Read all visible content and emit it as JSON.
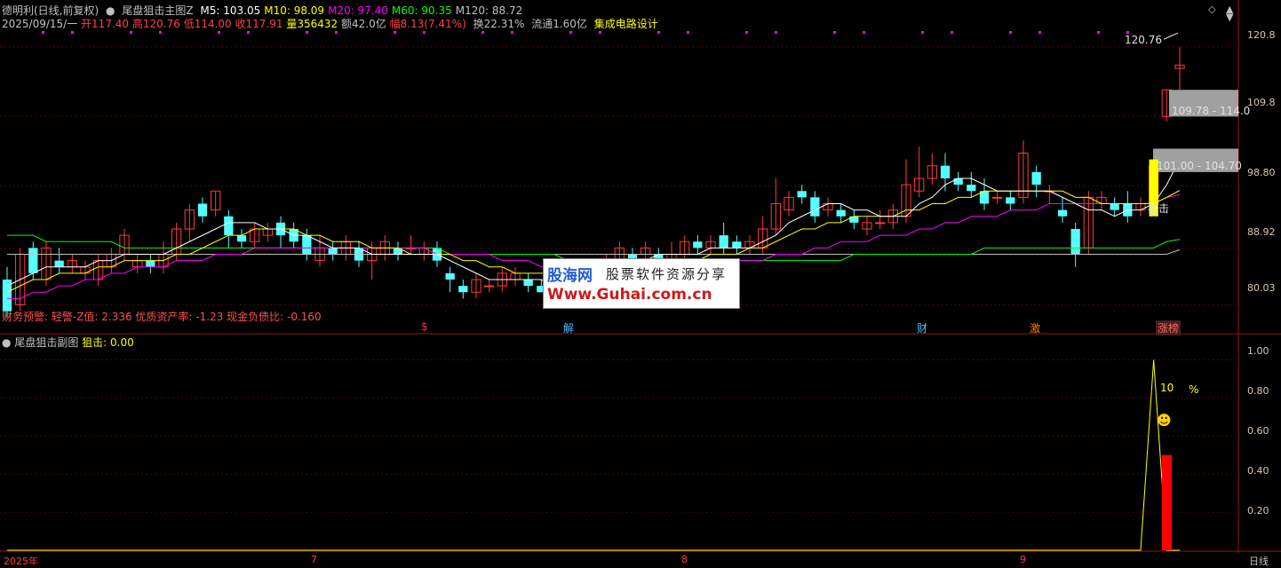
{
  "main_panel": {
    "title": "德明利(日线,前复权)",
    "indicator_name": "尾盘狙击主图Z",
    "ma": [
      {
        "label": "M5: 103.05",
        "color": "#ffffff"
      },
      {
        "label": "M10: 98.09",
        "color": "#ffff00"
      },
      {
        "label": "M20: 97.40",
        "color": "#ff00ff"
      },
      {
        "label": "M60: 90.35",
        "color": "#00ff00"
      },
      {
        "label": "M120: 88.72",
        "color": "#c0c0c0"
      }
    ],
    "quote": {
      "date": "2025/09/15/一",
      "open": "开117.40",
      "high": "高120.76",
      "low": "低114.00",
      "close": "收117.91",
      "volume": "量356432",
      "amount": "额42.0亿",
      "change": "幅8.13(7.41%)",
      "turnover": "换22.31%",
      "float": "流通1.60亿",
      "sector": "集成电路设计"
    },
    "finance_note": "财务预警: 轻警-Z值: 2.336 优质资产率: -1.23 现金负债比: -0.160",
    "price_ticks": [
      "120.8",
      "109.8",
      "98.80",
      "88.92",
      "80.03"
    ],
    "high_label": "120.76",
    "zone_labels": [
      "109.78 - 114.0",
      "101.00 - 104.70"
    ],
    "signal_label": "狙击",
    "events": [
      {
        "text": "$",
        "color": "#ff3030"
      },
      {
        "text": "解",
        "color": "#40c0ff"
      },
      {
        "text": "财",
        "color": "#40c0ff"
      },
      {
        "text": "激",
        "color": "#ff8000"
      },
      {
        "text": "涨榜",
        "color": "#ff6060"
      }
    ]
  },
  "sub_panel": {
    "title": "尾盘狙击副图",
    "value": "狙击: 0.00",
    "ticks": [
      "1.00",
      "0.80",
      "0.60",
      "0.40",
      "0.20"
    ],
    "annotation_value": "10",
    "annotation_unit": "%",
    "smiley": "☻"
  },
  "x_axis": {
    "labels": [
      "2025年",
      "7",
      "8",
      "9"
    ],
    "period": "日线"
  },
  "watermark": {
    "name": "股海网",
    "slogan": "股票软件资源分享",
    "url": "Www.Guhai.com.cn"
  },
  "window_controls": [
    "◇",
    "▲",
    "▼"
  ],
  "chart_data": {
    "type": "candlestick",
    "ylim": [
      76,
      124
    ],
    "candles": [
      [
        84,
        79,
        86,
        78
      ],
      [
        80,
        88,
        89,
        79
      ],
      [
        89,
        85,
        90,
        84
      ],
      [
        84,
        89,
        90,
        83
      ],
      [
        87,
        86,
        89,
        85
      ],
      [
        86,
        87,
        88,
        85
      ],
      [
        85,
        86,
        87,
        84
      ],
      [
        84,
        87,
        88,
        83
      ],
      [
        86,
        88,
        89,
        85
      ],
      [
        88,
        91,
        92,
        87
      ],
      [
        86,
        87,
        88,
        85
      ],
      [
        87,
        86,
        88,
        85
      ],
      [
        86,
        88,
        90,
        85
      ],
      [
        88,
        92,
        93,
        87
      ],
      [
        92,
        95,
        96,
        90
      ],
      [
        96,
        94,
        97,
        93
      ],
      [
        95,
        98,
        98,
        94
      ],
      [
        94,
        91,
        95,
        89
      ],
      [
        91,
        90,
        92,
        89
      ],
      [
        90,
        92,
        93,
        89
      ],
      [
        91,
        92,
        93,
        90
      ],
      [
        93,
        91,
        94,
        89
      ],
      [
        92,
        90,
        93,
        89
      ],
      [
        91,
        88,
        92,
        87
      ],
      [
        87,
        89,
        91,
        86
      ],
      [
        89,
        88,
        90,
        87
      ],
      [
        88,
        90,
        91,
        87
      ],
      [
        89,
        87,
        90,
        86
      ],
      [
        87,
        89,
        90,
        84
      ],
      [
        88,
        90,
        91,
        87
      ],
      [
        89,
        88,
        90,
        87
      ],
      [
        89,
        89,
        91,
        88
      ],
      [
        88,
        89,
        90,
        87
      ],
      [
        89,
        87,
        90,
        86
      ],
      [
        85,
        84,
        86,
        82
      ],
      [
        83,
        82,
        84,
        81
      ],
      [
        82,
        84,
        85,
        81
      ],
      [
        83,
        83,
        84,
        82
      ],
      [
        83,
        85,
        86,
        82
      ],
      [
        84,
        85,
        86,
        83
      ],
      [
        84,
        83,
        85,
        82
      ],
      [
        83,
        82,
        84,
        82
      ],
      [
        82,
        82,
        83,
        81
      ],
      [
        82,
        84,
        86,
        81
      ],
      [
        84,
        86,
        87,
        83
      ],
      [
        85,
        83,
        86,
        82
      ],
      [
        84,
        87,
        88,
        83
      ],
      [
        87,
        89,
        90,
        86
      ],
      [
        88,
        87,
        89,
        86
      ],
      [
        88,
        89,
        90,
        87
      ],
      [
        88,
        86,
        89,
        85
      ],
      [
        87,
        88,
        90,
        86
      ],
      [
        88,
        90,
        91,
        87
      ],
      [
        90,
        89,
        91,
        88
      ],
      [
        89,
        90,
        91,
        88
      ],
      [
        91,
        89,
        93,
        88
      ],
      [
        90,
        89,
        91,
        88
      ],
      [
        89,
        90,
        91,
        88
      ],
      [
        89,
        92,
        94,
        88
      ],
      [
        92,
        96,
        100,
        91
      ],
      [
        95,
        97,
        98,
        94
      ],
      [
        98,
        97,
        99,
        96
      ],
      [
        97,
        94,
        98,
        93
      ],
      [
        95,
        96,
        97,
        94
      ],
      [
        95,
        94,
        96,
        93
      ],
      [
        94,
        93,
        95,
        92
      ],
      [
        92,
        93,
        94,
        91
      ],
      [
        93,
        93,
        95,
        92
      ],
      [
        93,
        95,
        96,
        92
      ],
      [
        94,
        99,
        103,
        93
      ],
      [
        98,
        100,
        105,
        97
      ],
      [
        100,
        102,
        104,
        99
      ],
      [
        102,
        100,
        104,
        98
      ],
      [
        100,
        99,
        101,
        98
      ],
      [
        99,
        98,
        101,
        97
      ],
      [
        98,
        96,
        100,
        95
      ],
      [
        97,
        97,
        98,
        96
      ],
      [
        97,
        96,
        98,
        95
      ],
      [
        97,
        104,
        106,
        96
      ],
      [
        101,
        99,
        102,
        97
      ],
      [
        98,
        98,
        99,
        96
      ],
      [
        95,
        94,
        97,
        93
      ],
      [
        92,
        88,
        93,
        86
      ],
      [
        89,
        97,
        98,
        88
      ],
      [
        96,
        97,
        98,
        95
      ],
      [
        96,
        95,
        97,
        94
      ],
      [
        96,
        94,
        98,
        93
      ],
      [
        95,
        96,
        97,
        94
      ],
      [
        96,
        102,
        104,
        95
      ],
      [
        109.78,
        114,
        114,
        109
      ],
      [
        117.4,
        117.91,
        120.76,
        114
      ]
    ],
    "ma5": [
      83,
      84,
      85,
      86,
      86,
      86,
      86,
      87,
      87,
      88,
      88,
      88,
      88,
      89,
      90,
      91,
      92,
      93,
      93,
      93,
      92,
      92,
      91,
      91,
      90,
      89,
      89,
      89,
      88,
      88,
      88,
      88,
      88,
      88,
      87,
      86,
      85,
      84,
      84,
      84,
      84,
      84,
      83,
      83,
      84,
      84,
      84,
      85,
      86,
      87,
      88,
      88,
      88,
      88,
      89,
      89,
      89,
      89,
      90,
      91,
      93,
      94,
      95,
      96,
      96,
      95,
      95,
      94,
      94,
      94,
      96,
      97,
      99,
      100,
      100,
      99,
      98,
      98,
      98,
      98,
      98,
      97,
      96,
      95,
      95,
      94,
      95,
      95,
      96,
      99,
      103.05
    ],
    "ma10": [
      82,
      83,
      84,
      84,
      85,
      85,
      85,
      86,
      86,
      87,
      87,
      87,
      87,
      88,
      88,
      89,
      90,
      91,
      91,
      92,
      92,
      92,
      92,
      91,
      91,
      90,
      90,
      90,
      89,
      89,
      89,
      88,
      88,
      88,
      88,
      87,
      87,
      86,
      86,
      85,
      85,
      85,
      85,
      84,
      84,
      84,
      84,
      85,
      85,
      86,
      86,
      87,
      87,
      87,
      88,
      88,
      88,
      89,
      89,
      90,
      91,
      92,
      92,
      93,
      93,
      94,
      94,
      94,
      94,
      95,
      95,
      96,
      96,
      97,
      97,
      98,
      98,
      98,
      98,
      98,
      98,
      98,
      97,
      97,
      96,
      96,
      96,
      96,
      96,
      97,
      98.09
    ],
    "ma20": [
      81,
      81,
      82,
      82,
      83,
      83,
      84,
      84,
      85,
      85,
      86,
      86,
      86,
      87,
      87,
      87,
      88,
      88,
      88,
      89,
      89,
      89,
      89,
      89,
      89,
      89,
      89,
      89,
      89,
      89,
      89,
      89,
      89,
      88,
      88,
      88,
      88,
      88,
      87,
      87,
      87,
      86,
      86,
      86,
      86,
      86,
      86,
      86,
      86,
      86,
      86,
      86,
      86,
      86,
      86,
      87,
      87,
      87,
      87,
      88,
      88,
      88,
      89,
      89,
      90,
      90,
      90,
      91,
      91,
      91,
      92,
      92,
      93,
      93,
      94,
      94,
      94,
      95,
      95,
      95,
      96,
      96,
      96,
      96,
      96,
      96,
      96,
      96,
      96,
      97,
      97.4
    ],
    "ma60": [
      91,
      91,
      91,
      90,
      90,
      90,
      90,
      90,
      90,
      89,
      89,
      89,
      89,
      89,
      89,
      89,
      89,
      89,
      89,
      89,
      89,
      89,
      89,
      89,
      89,
      89,
      89,
      89,
      89,
      89,
      89,
      89,
      89,
      89,
      88,
      88,
      88,
      88,
      88,
      88,
      88,
      88,
      88,
      87,
      87,
      87,
      87,
      87,
      87,
      87,
      87,
      87,
      87,
      87,
      87,
      87,
      87,
      87,
      87,
      87,
      87,
      87,
      87,
      87,
      87,
      88,
      88,
      88,
      88,
      88,
      88,
      88,
      88,
      88,
      88,
      89,
      89,
      89,
      89,
      89,
      89,
      89,
      89,
      89,
      89,
      89,
      89,
      89,
      89,
      90,
      90.35
    ],
    "ma120": [
      88,
      88,
      88,
      88,
      88,
      88,
      88,
      88,
      88,
      88,
      88,
      88,
      88,
      88,
      88,
      88,
      88,
      88,
      88,
      88,
      88,
      88,
      88,
      88,
      88,
      88,
      88,
      88,
      88,
      88,
      88,
      88,
      88,
      88,
      88,
      88,
      88,
      88,
      88,
      88,
      88,
      88,
      88,
      88,
      88,
      88,
      88,
      88,
      88,
      88,
      88,
      88,
      88,
      88,
      88,
      88,
      88,
      88,
      88,
      88,
      88,
      88,
      88,
      88,
      88,
      88,
      88,
      88,
      88,
      88,
      88,
      88,
      88,
      88,
      88,
      88,
      88,
      88,
      88,
      88,
      88,
      88,
      88,
      88,
      88,
      88,
      88,
      88,
      88,
      88,
      88.72
    ],
    "zones": [
      [
        109.78,
        114.0
      ],
      [
        101.0,
        104.7
      ]
    ],
    "sub_series": {
      "ylim": [
        0,
        1.1
      ],
      "spike_index": 88,
      "spike_value": 1.0,
      "bar_value": 0.5
    }
  }
}
